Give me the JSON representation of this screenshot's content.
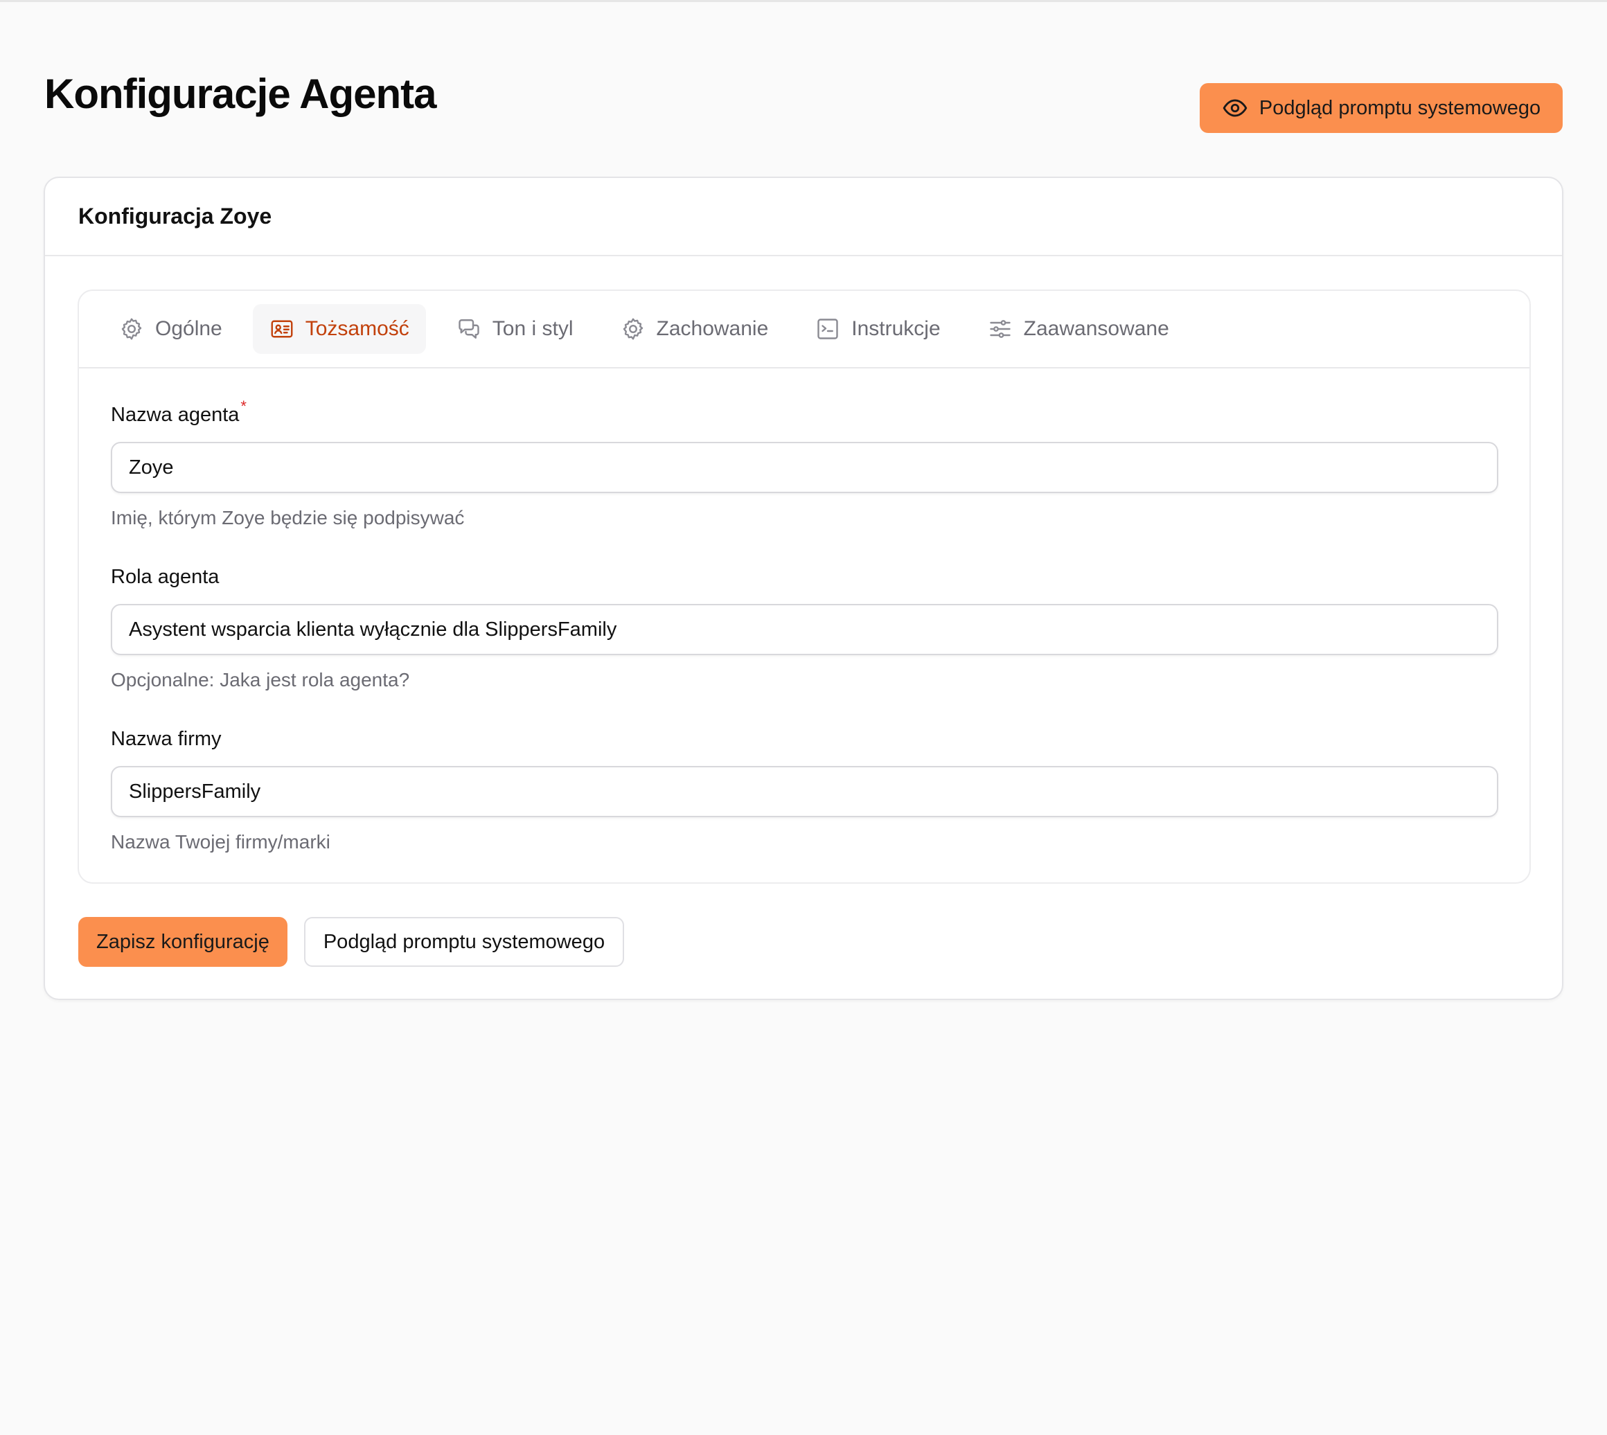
{
  "header": {
    "title": "Konfiguracje Agenta",
    "preview_button_label": "Podgląd promptu systemowego"
  },
  "card": {
    "title": "Konfiguracja Zoye"
  },
  "tabs": [
    {
      "label": "Ogólne",
      "icon": "gear-icon",
      "active": false
    },
    {
      "label": "Tożsamość",
      "icon": "id-card-icon",
      "active": true
    },
    {
      "label": "Ton i styl",
      "icon": "chat-bubbles-icon",
      "active": false
    },
    {
      "label": "Zachowanie",
      "icon": "gear-icon",
      "active": false
    },
    {
      "label": "Instrukcje",
      "icon": "terminal-icon",
      "active": false
    },
    {
      "label": "Zaawansowane",
      "icon": "sliders-icon",
      "active": false
    }
  ],
  "form": {
    "agent_name": {
      "label": "Nazwa agenta",
      "required_mark": "*",
      "value": "Zoye",
      "help": "Imię, którym Zoye będzie się podpisywać"
    },
    "agent_role": {
      "label": "Rola agenta",
      "value": "Asystent wsparcia klienta wyłącznie dla SlippersFamily",
      "help": "Opcjonalne: Jaka jest rola agenta?"
    },
    "company_name": {
      "label": "Nazwa firmy",
      "value": "SlippersFamily",
      "help": "Nazwa Twojej firmy/marki"
    }
  },
  "actions": {
    "save_label": "Zapisz konfigurację",
    "preview_label": "Podgląd promptu systemowego"
  },
  "colors": {
    "accent": "#fb8f4e",
    "active_tab_text": "#c2410c",
    "required": "#dc2626"
  }
}
